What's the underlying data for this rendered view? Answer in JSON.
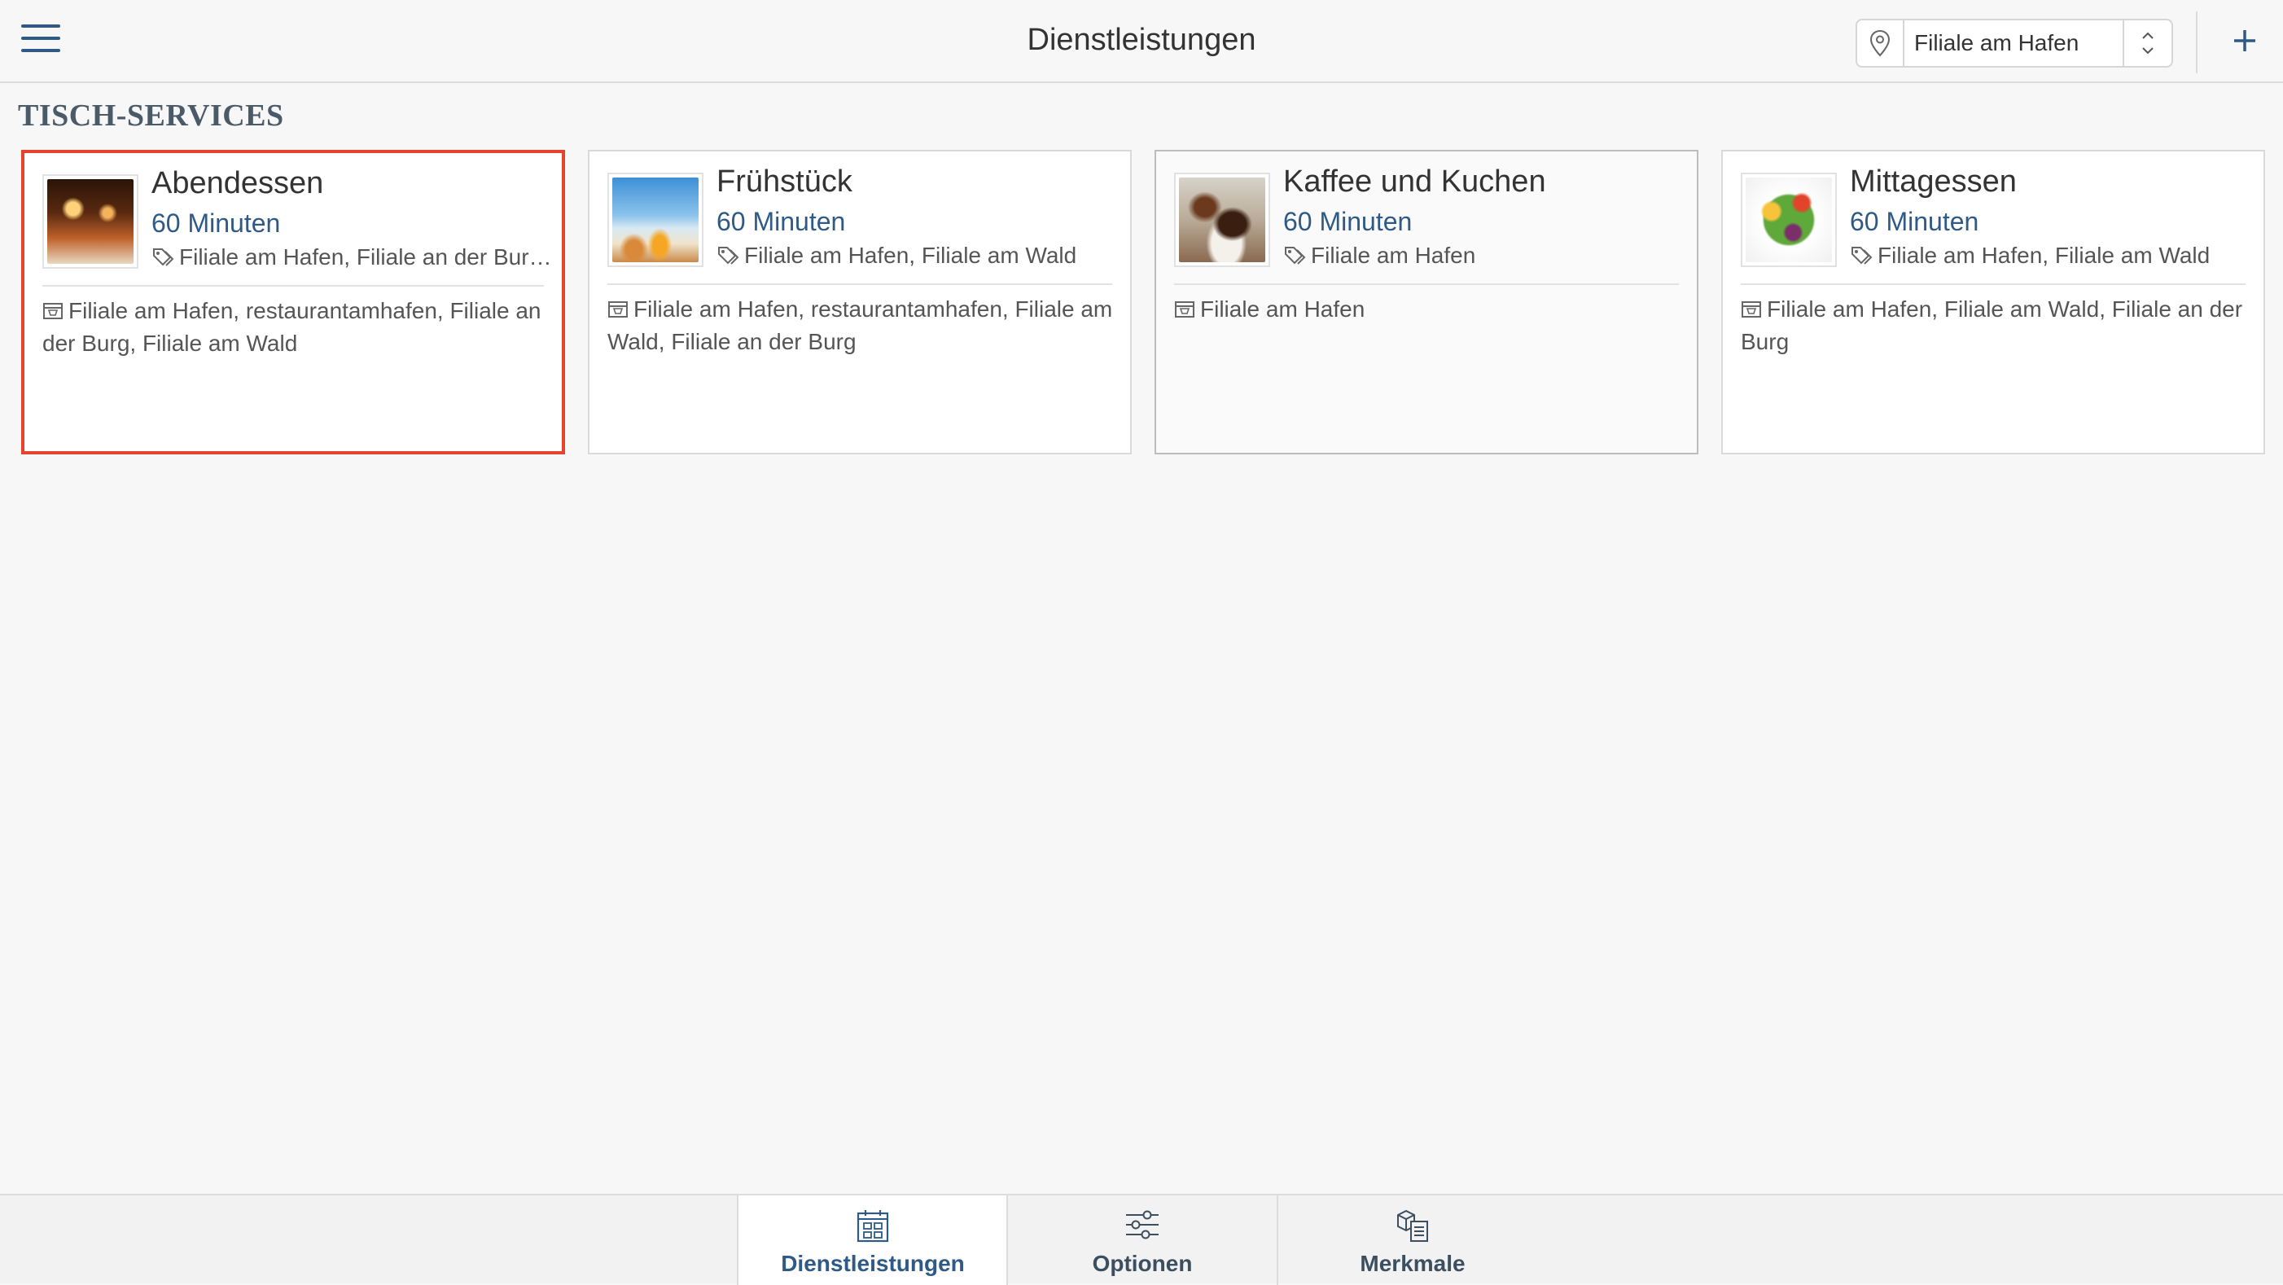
{
  "header": {
    "title": "Dienstleistungen",
    "location_value": "Filiale am Hafen"
  },
  "section": {
    "heading": "TISCH-SERVICES"
  },
  "services": [
    {
      "name": "Abendessen",
      "duration": "60 Minuten",
      "stores": "Filiale am Hafen, Filiale an der Burg, Filiale am Wald",
      "rooms": "Filiale am Hafen, restaurantamhafen, Filiale an der Burg, Filiale am Wald",
      "image": "dinner-photo"
    },
    {
      "name": "Frühstück",
      "duration": "60 Minuten",
      "stores": "Filiale am Hafen, Filiale am Wald",
      "rooms": "Filiale am Hafen, restaurantamhafen, Filiale am Wald, Filiale an der Burg",
      "image": "breakfast-photo"
    },
    {
      "name": "Kaffee und Kuchen",
      "duration": "60 Minuten",
      "stores": "Filiale am Hafen",
      "rooms": "Filiale am Hafen",
      "image": "coffee-cake-photo"
    },
    {
      "name": "Mittagessen",
      "duration": "60 Minuten",
      "stores": "Filiale am Hafen, Filiale am Wald",
      "rooms": "Filiale am Hafen, Filiale am Wald, Filiale an der Burg",
      "image": "lunch-bowl-photo"
    }
  ],
  "bottom_nav": {
    "tabs": [
      {
        "label": "Dienstleistungen",
        "icon": "calendar-grid-icon",
        "active": true
      },
      {
        "label": "Optionen",
        "icon": "sliders-icon",
        "active": false
      },
      {
        "label": "Merkmale",
        "icon": "features-list-icon",
        "active": false
      }
    ]
  },
  "colors": {
    "accent": "#2e5a85",
    "selected_border": "#e5432e",
    "heading": "#4a5a68"
  }
}
